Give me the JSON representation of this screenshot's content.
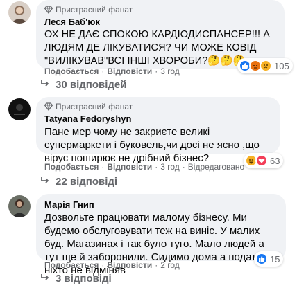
{
  "comments": [
    {
      "badge": "Пристрасний фанат",
      "author": "Леся Баб'юк",
      "text": "ОХ НЕ ДАЄ СПОКОЮ КАРДІОДИСПАНСЕР!!! А ЛЮДЯМ ДЕ ЛІКУВАТИСЯ? ЧИ МОЖЕ КОВІД \"ВИЛІКУВАВ\"ВСІ ІНШІ ХВОРОБИ?🤔🤔🤔",
      "like": "Подобається",
      "reply": "Відповісти",
      "time": "3 год",
      "reactions_count": "105",
      "replies_label": "30 відповідей"
    },
    {
      "badge": "Пристрасний фанат",
      "author": "Tatyana Fedoryshyn",
      "text": "Пане мер чому не закриєте великі супермаркети і буковель,чи досі не ясно ,що вірус поширює не дрібний бізнес?",
      "like": "Подобається",
      "reply": "Відповісти",
      "time": "3 год",
      "edited": "Відредаговано",
      "reactions_count": "63",
      "replies_label": "22 відповіді"
    },
    {
      "author": "Марія Гнип",
      "text": "Дозвольте працювати малому бізнесу. Ми будемо обслуговувати теж на виніс. У малих буд. Магазинах і так було туго. Мало людей а тут ще й заборонили. Сидимо дома а податки ніхто не відміняв",
      "like": "Подобається",
      "reply": "Відповісти",
      "time": "2 год",
      "reactions_count": "15",
      "replies_label": "3 відповіді"
    }
  ],
  "colors": {
    "bubble": "#f0f2f5",
    "secondary_text": "#65676b",
    "like_blue": "#1877f2",
    "love_red": "#f33e58",
    "haha_yellow": "#f7b125",
    "angry_orange": "#e9710f"
  },
  "icons": {
    "badge": "diamond-fan-icon",
    "replies": "reply-arrow-icon",
    "reactions": [
      "like-icon",
      "angry-icon",
      "sad-icon",
      "haha-icon",
      "love-icon"
    ]
  }
}
